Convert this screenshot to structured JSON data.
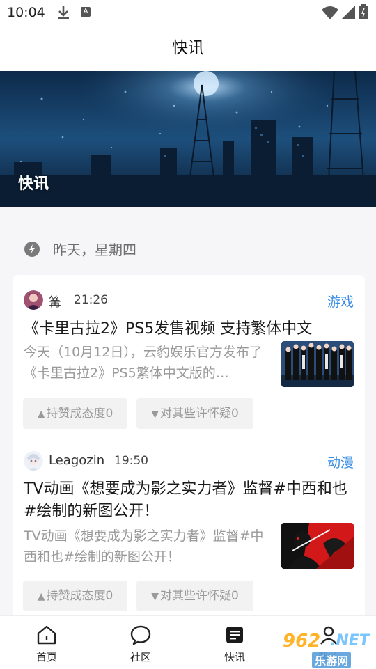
{
  "status_bar": {
    "time": "10:04",
    "a_badge": "A"
  },
  "header": {
    "title": "快讯"
  },
  "banner": {
    "label": "快讯"
  },
  "date_header": {
    "text": "昨天，星期四"
  },
  "news": [
    {
      "author": "篝",
      "time": "21:26",
      "tag": "游戏",
      "headline": "《卡里古拉2》PS5发售视频 支持繁体中文",
      "summary": "今天（10月12日），云豹娱乐官方发布了《卡里古拉2》PS5繁体中文版的…",
      "upvote_label": "持赞成态度0",
      "downvote_label": "对其些许怀疑0"
    },
    {
      "author": "Leagozin",
      "time": "19:50",
      "tag": "动漫",
      "headline": "TV动画《想要成为影之实力者》监督#中西和也#绘制的新图公开！",
      "summary": "TV动画《想要成为影之实力者》监督#中西和也#绘制的新图公开！",
      "upvote_label": "持赞成态度0",
      "downvote_label": "对其些许怀疑0"
    }
  ],
  "tab_bar": {
    "items": [
      {
        "label": "首页",
        "icon": "home-icon"
      },
      {
        "label": "社区",
        "icon": "chat-bubble-icon"
      },
      {
        "label": "快讯",
        "icon": "news-icon"
      },
      {
        "label": "我的",
        "icon": "profile-icon"
      }
    ]
  },
  "watermark": {
    "number": "962",
    "net": ".NET",
    "sub": "乐游网"
  },
  "colors": {
    "accent": "#3a8ee6",
    "muted": "#999999",
    "button_bg": "#f2f2f2"
  }
}
